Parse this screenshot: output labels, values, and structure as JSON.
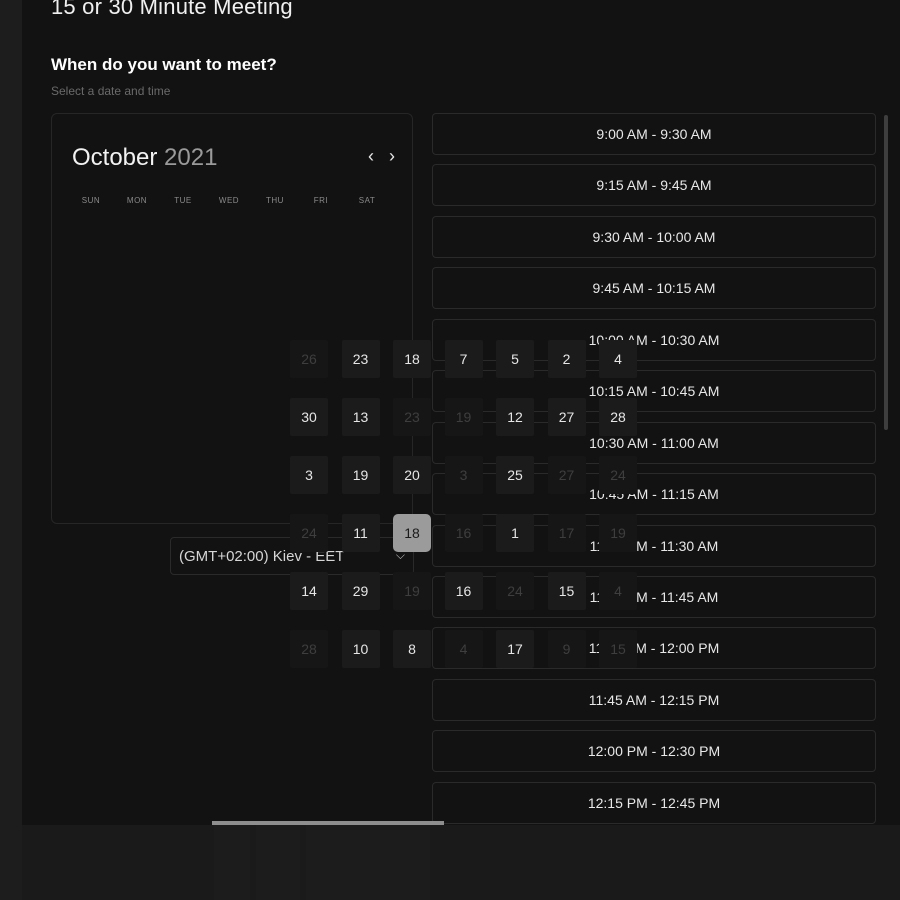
{
  "page": {
    "title": "15 or 30 Minute Meeting",
    "question": "When do you want to meet?",
    "hint": "Select a date and time"
  },
  "calendar": {
    "month": "October",
    "year": "2021",
    "prev_icon": "chevron-left-icon",
    "next_icon": "chevron-right-icon",
    "prev_glyph": "‹",
    "next_glyph": "›",
    "weekdays": [
      "SUN",
      "MON",
      "TUE",
      "WED",
      "THU",
      "FRI",
      "SAT"
    ]
  },
  "timezone": {
    "value": "(GMT+02:00) Kiev - EET",
    "caret_icon": "chevron-down-icon",
    "caret_glyph": "⌵"
  },
  "slots": [
    "9:00 AM - 9:30 AM",
    "9:15 AM - 9:45 AM",
    "9:30 AM - 10:00 AM",
    "9:45 AM - 10:15 AM",
    "10:00 AM - 10:30 AM",
    "10:15 AM - 10:45 AM",
    "10:30 AM - 11:00 AM",
    "10:45 AM - 11:15 AM",
    "11:00 AM - 11:30 AM",
    "11:15 AM - 11:45 AM",
    "11:30 AM - 12:00 PM",
    "11:45 AM - 12:15 PM",
    "12:00 PM - 12:30 PM",
    "12:15 PM - 12:45 PM"
  ],
  "date_grid": [
    [
      "26",
      "23",
      "18",
      "7",
      "5",
      "2",
      "4"
    ],
    [
      "30",
      "13",
      "23",
      "19",
      "12",
      "27",
      "28"
    ],
    [
      "3",
      "19",
      "20",
      "3",
      "25",
      "27",
      "24"
    ],
    [
      "24",
      "11",
      "18",
      "16",
      "1",
      "17",
      "19"
    ],
    [
      "14",
      "29",
      "19",
      "16",
      "24",
      "15",
      "4"
    ],
    [
      "28",
      "10",
      "8",
      "4",
      "17",
      "9",
      "15"
    ]
  ],
  "date_dim": [
    [
      true,
      false,
      false,
      false,
      false,
      false,
      false
    ],
    [
      false,
      false,
      true,
      true,
      false,
      false,
      false
    ],
    [
      false,
      false,
      false,
      true,
      false,
      true,
      true
    ],
    [
      true,
      false,
      false,
      true,
      false,
      true,
      true
    ],
    [
      false,
      false,
      true,
      false,
      true,
      false,
      true
    ],
    [
      true,
      false,
      false,
      true,
      false,
      true,
      true
    ]
  ],
  "selected_date": "18",
  "colors": {
    "background": "#121212",
    "selected_day": "#9b9b9b",
    "border": "#2a2a2a"
  }
}
